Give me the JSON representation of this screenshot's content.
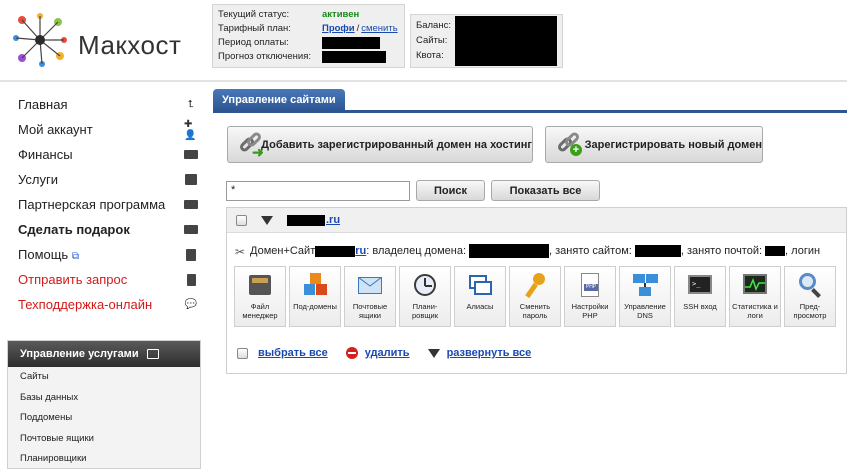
{
  "logo": {
    "text": "Макхост"
  },
  "status": {
    "current_status_label": "Текущий статус:",
    "current_status_value": "активен",
    "tariff_label": "Тарифный план:",
    "tariff_value": "Профи",
    "tariff_separator": "/",
    "tariff_change": "сменить",
    "payment_period_label": "Период оплаты:",
    "shutdown_forecast_label": "Прогноз отключения:"
  },
  "account": {
    "balance_label": "Баланс:",
    "sites_label": "Сайты:",
    "quota_label": "Квота:"
  },
  "menu": [
    {
      "label": "Главная",
      "icon": "home-arrow-icon"
    },
    {
      "label": "Мой аккаунт",
      "icon": "user-icon"
    },
    {
      "label": "Финансы",
      "icon": "wallet-icon"
    },
    {
      "label": "Услуги",
      "icon": "list-icon"
    },
    {
      "label": "Партнерская программа",
      "icon": "partner-icon"
    },
    {
      "label": "Сделать подарок",
      "icon": "gift-icon"
    },
    {
      "label": "Помощь",
      "icon": "help-icon"
    },
    {
      "label": "Отправить запрос",
      "icon": "request-icon"
    },
    {
      "label": "Техподдержка-онлайн",
      "icon": "chat-icon"
    }
  ],
  "services_panel": {
    "title": "Управление услугами",
    "items": [
      "Сайты",
      "Базы данных",
      "Поддомены",
      "Почтовые ящики",
      "Планировщики"
    ]
  },
  "main": {
    "tab_label": "Управление сайтами",
    "add_domain_button": "Добавить зарегистрированный домен на хостинг",
    "register_domain_button": "Зарегистрировать новый домен",
    "search_value": "*",
    "search_button": "Поиск",
    "show_all_button": "Показать все",
    "domain_suffix": ".ru",
    "info": {
      "prefix": "Домен+Сайт",
      "suffix": "ru",
      "owner": ": владелец домена:",
      "used_by_site": ", занято сайтом:",
      "used_by_mail": ", занято почтой:",
      "login": ", логин"
    },
    "tools": [
      {
        "label": "Файл менеджер",
        "icon": "file-manager-icon"
      },
      {
        "label": "Под-домены",
        "icon": "subdomains-icon"
      },
      {
        "label": "Почтовые ящики",
        "icon": "mailbox-icon"
      },
      {
        "label": "Плани-ровщик",
        "icon": "scheduler-icon"
      },
      {
        "label": "Алиасы",
        "icon": "aliases-icon"
      },
      {
        "label": "Сменить пароль",
        "icon": "key-icon"
      },
      {
        "label": "Настройки PHP",
        "icon": "php-icon"
      },
      {
        "label": "Управление DNS",
        "icon": "dns-icon"
      },
      {
        "label": "SSH вход",
        "icon": "ssh-icon"
      },
      {
        "label": "Статистика и логи",
        "icon": "stats-icon"
      },
      {
        "label": "Пред-просмотр",
        "icon": "preview-icon"
      }
    ],
    "select_all": "выбрать все",
    "delete": "удалить",
    "expand_all": "развернуть все"
  },
  "colors": {
    "accent": "#2c5592",
    "link": "#1a4ab0",
    "status_green": "#1a8a1a",
    "alert_red": "#d21a1a"
  }
}
